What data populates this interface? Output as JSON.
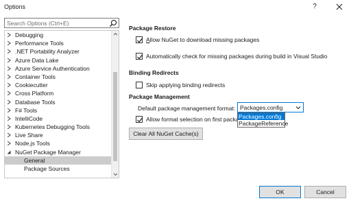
{
  "window": {
    "title": "Options",
    "help_label": "?"
  },
  "search": {
    "placeholder": "Search Options (Ctrl+E)",
    "value": ""
  },
  "tree": {
    "items": [
      {
        "label": "Debugging",
        "expanded": false
      },
      {
        "label": "Performance Tools",
        "expanded": false
      },
      {
        "label": ".NET Portability Analyzer",
        "expanded": false
      },
      {
        "label": "Azure Data Lake",
        "expanded": false
      },
      {
        "label": "Azure Service Authentication",
        "expanded": false
      },
      {
        "label": "Container Tools",
        "expanded": false
      },
      {
        "label": "Cookiecutter",
        "expanded": false
      },
      {
        "label": "Cross Platform",
        "expanded": false
      },
      {
        "label": "Database Tools",
        "expanded": false
      },
      {
        "label": "F# Tools",
        "expanded": false
      },
      {
        "label": "IntelliCode",
        "expanded": false
      },
      {
        "label": "Kubernetes Debugging Tools",
        "expanded": false
      },
      {
        "label": "Live Share",
        "expanded": false
      },
      {
        "label": "Node.js Tools",
        "expanded": false
      },
      {
        "label": "NuGet Package Manager",
        "expanded": true
      },
      {
        "label": "General",
        "child": true,
        "selected": true
      },
      {
        "label": "Package Sources",
        "child": true
      }
    ]
  },
  "package_restore": {
    "header": "Package Restore",
    "allow_download": {
      "label": "Allow NuGet to download missing packages",
      "checked": true
    },
    "auto_check": {
      "label": "Automatically check for missing packages during build in Visual Studio",
      "checked": true
    }
  },
  "binding_redirects": {
    "header": "Binding Redirects",
    "skip": {
      "label": "Skip applying binding redirects",
      "checked": false
    }
  },
  "package_management": {
    "header": "Package Management",
    "format_label": "Default package management format:",
    "format_value": "Packages.config",
    "format_options": [
      "Packages.config",
      "PackageReference"
    ],
    "allow_format": {
      "label": "Allow format selection on first packa",
      "checked": true
    }
  },
  "buttons": {
    "clear_cache": "Clear All NuGet Cache(s)",
    "ok": "OK",
    "cancel": "Cancel"
  },
  "colors": {
    "accent": "#0078d7",
    "selected_tree_bg": "#cccccc"
  }
}
